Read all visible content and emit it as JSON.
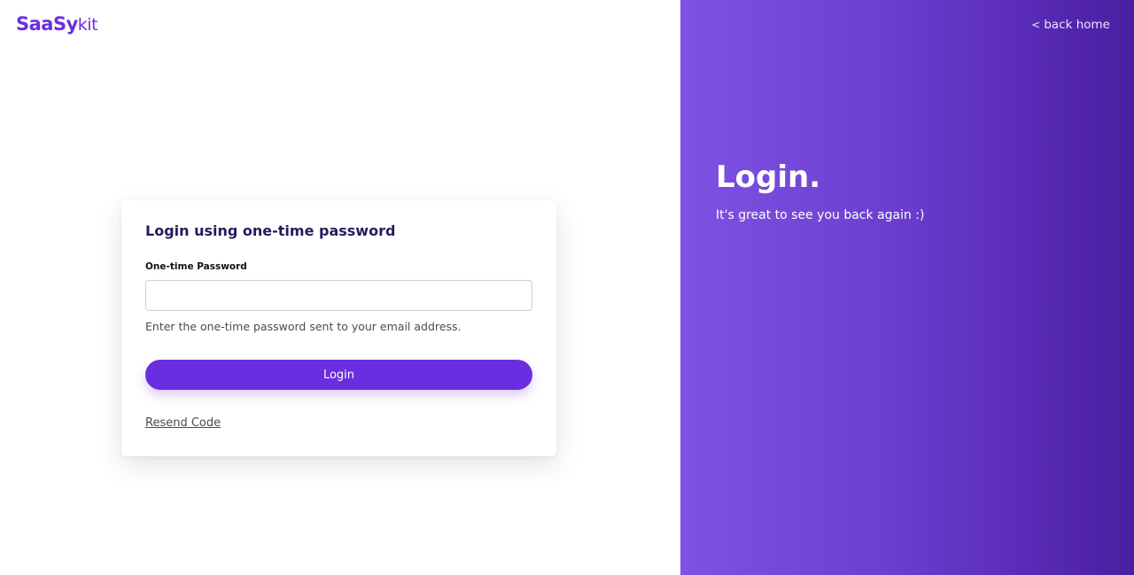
{
  "brand": {
    "name_bold": "SaaSy",
    "name_light": "kit",
    "accent_color": "#6a2ee0"
  },
  "login_card": {
    "title": "Login using one-time password",
    "otp_field": {
      "label": "One-time Password",
      "value": "",
      "placeholder": ""
    },
    "helper_text": "Enter the one-time password sent to your email address.",
    "login_button_label": "Login",
    "resend_link_label": "Resend Code"
  },
  "hero": {
    "back_home_chevron": "<",
    "back_home_label": "back home",
    "title": "Login.",
    "subtitle": "It's great to see you back again :)",
    "gradient_colors": [
      "#7f52e3",
      "#4a1fa0"
    ]
  }
}
